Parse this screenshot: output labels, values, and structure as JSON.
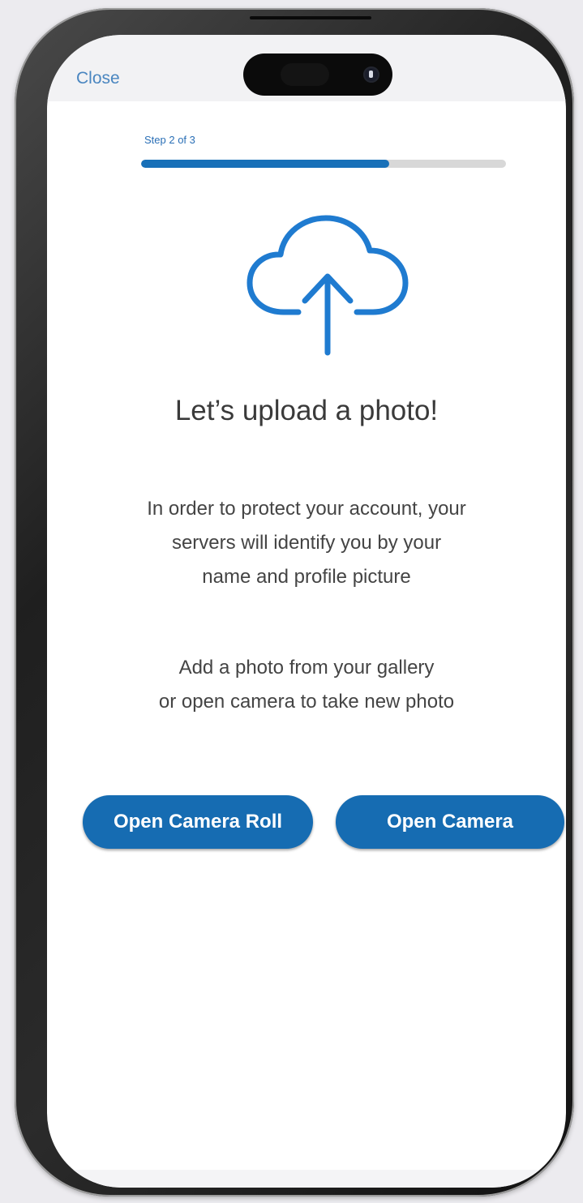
{
  "nav": {
    "close_label": "Close"
  },
  "progress": {
    "label": "Step 2 of 3",
    "current_step": 2,
    "total_steps": 3,
    "fill_fraction": 0.68
  },
  "icons": {
    "upload": "cloud-upload-icon"
  },
  "content": {
    "headline": "Let’s upload a photo!",
    "explanation_lines": [
      "In order to protect your account, your",
      "servers will identify you by your",
      "name and profile picture"
    ],
    "instruction_lines": [
      "Add a photo from your gallery",
      "or open camera to take new photo"
    ]
  },
  "actions": {
    "camera_roll_label": "Open Camera Roll",
    "camera_label": "Open Camera"
  },
  "colors": {
    "accent": "#166cb2",
    "link": "#4a86c0",
    "progress_track": "#d8d8d8"
  }
}
